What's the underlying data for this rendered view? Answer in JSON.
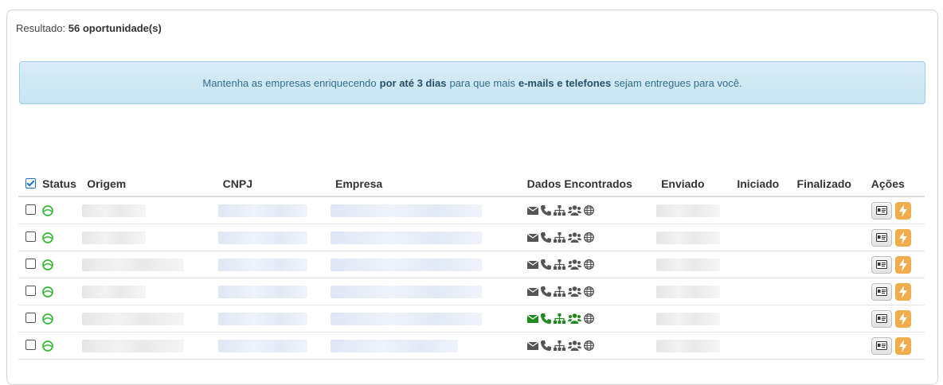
{
  "result": {
    "label": "Resultado:",
    "count": "56 oportunidade(s)"
  },
  "alert": {
    "part1": "Mantenha as empresas enriquecendo",
    "bold1": "por até 3 dias",
    "part2": "para que mais",
    "bold2": "e-mails e telefones",
    "part3": "sejam entregues para você."
  },
  "table": {
    "headers": {
      "status": "Status",
      "origem": "Origem",
      "cnpj": "CNPJ",
      "empresa": "Empresa",
      "dados": "Dados Encontrados",
      "enviado": "Enviado",
      "iniciado": "Iniciado",
      "finalizado": "Finalizado",
      "acoes": "Ações"
    },
    "rows": [
      {
        "status": "ok",
        "highlight": false
      },
      {
        "status": "ok",
        "highlight": false
      },
      {
        "status": "ok",
        "highlight": false
      },
      {
        "status": "ok",
        "highlight": false
      },
      {
        "status": "ok",
        "highlight": true
      },
      {
        "status": "ok",
        "highlight": false
      }
    ]
  },
  "colors": {
    "status_green": "#3cb83c",
    "icon_gray": "#555555",
    "icon_green": "#1f8a1f",
    "alert_text": "#31708f",
    "bolt_orange": "#f0ad4e"
  },
  "icons": [
    "envelope-icon",
    "phone-icon",
    "sitemap-icon",
    "users-icon",
    "globe-icon",
    "id-card-icon",
    "bolt-icon",
    "status-icon"
  ]
}
